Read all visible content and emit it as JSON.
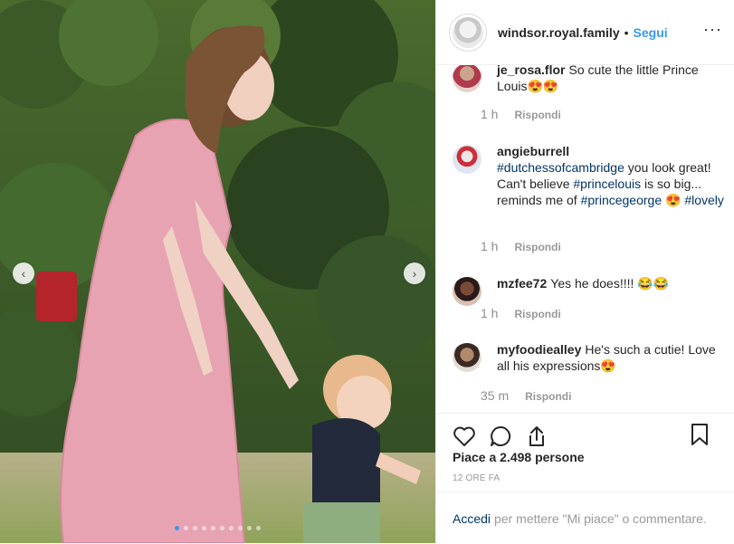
{
  "post": {
    "username": "windsor.royal.family",
    "separator": "•",
    "follow_label": "Segui",
    "more_label": "···"
  },
  "photo": {
    "slide_count": 10,
    "active_slide": 1
  },
  "comments": [
    {
      "user": "je_rosa.flor",
      "text": "So cute the little Prince Louis😍😍",
      "time": "1 h",
      "reply_label": "Rispondi"
    },
    {
      "user": "angieburrell",
      "parts": [
        "#dutchessofcambridge",
        " you look great! Can't believe ",
        "#princelouis",
        " is so big... reminds me of ",
        "#princegeorge",
        " 😍 ",
        "#lovely"
      ],
      "time": "1 h",
      "reply_label": "Rispondi"
    },
    {
      "user": "mzfee72",
      "text": "Yes he does!!!! 😂😂",
      "time": "1 h",
      "reply_label": "Rispondi"
    },
    {
      "user": "myfoodiealley",
      "text": "He's such a cutie! Love all his expressions😍",
      "time": "35 m",
      "reply_label": "Rispondi"
    }
  ],
  "likes": {
    "text": "Piace a 2.498 persone"
  },
  "timestamp": "12 ORE FA",
  "login_prompt": {
    "link": "Accedi",
    "text": "per mettere \"Mi piace\" o commentare."
  },
  "icons": {
    "like": "heart-icon",
    "comment": "comment-bubble-icon",
    "share": "share-icon",
    "save": "bookmark-icon",
    "prev": "chevron-left-icon",
    "next": "chevron-right-icon"
  },
  "colors": {
    "link_blue": "#3897f0",
    "hashtag": "#003569",
    "muted": "#999999",
    "text": "#262626"
  }
}
